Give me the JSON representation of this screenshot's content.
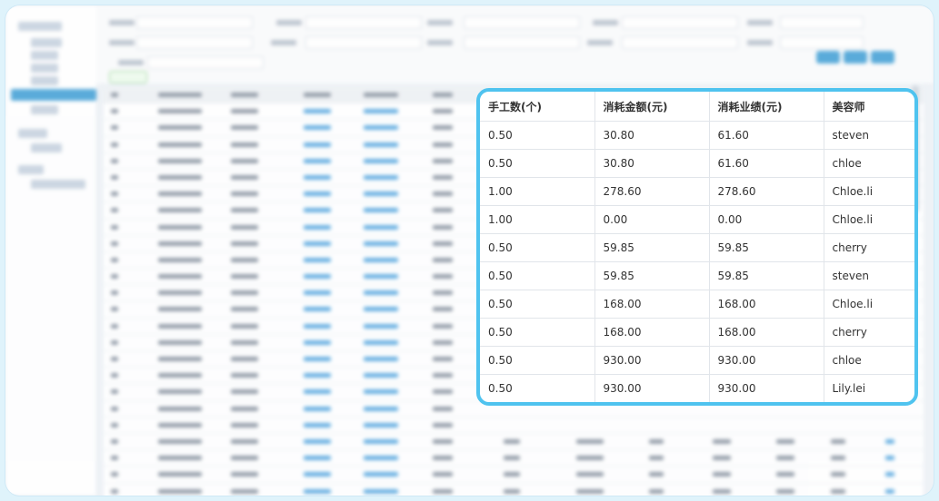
{
  "table": {
    "columns": [
      "手工数(个)",
      "消耗金额(元)",
      "消耗业绩(元)",
      "美容师"
    ],
    "rows": [
      [
        "0.50",
        "30.80",
        "61.60",
        "steven"
      ],
      [
        "0.50",
        "30.80",
        "61.60",
        "chloe"
      ],
      [
        "1.00",
        "278.60",
        "278.60",
        "Chloe.li"
      ],
      [
        "1.00",
        "0.00",
        "0.00",
        "Chloe.li"
      ],
      [
        "0.50",
        "59.85",
        "59.85",
        "cherry"
      ],
      [
        "0.50",
        "59.85",
        "59.85",
        "steven"
      ],
      [
        "0.50",
        "168.00",
        "168.00",
        "Chloe.li"
      ],
      [
        "0.50",
        "168.00",
        "168.00",
        "cherry"
      ],
      [
        "0.50",
        "930.00",
        "930.00",
        "chloe"
      ],
      [
        "0.50",
        "930.00",
        "930.00",
        "Lily.lei"
      ]
    ]
  },
  "colors": {
    "highlight_border": "#4fc3ef",
    "accent": "#4aa4d8"
  }
}
